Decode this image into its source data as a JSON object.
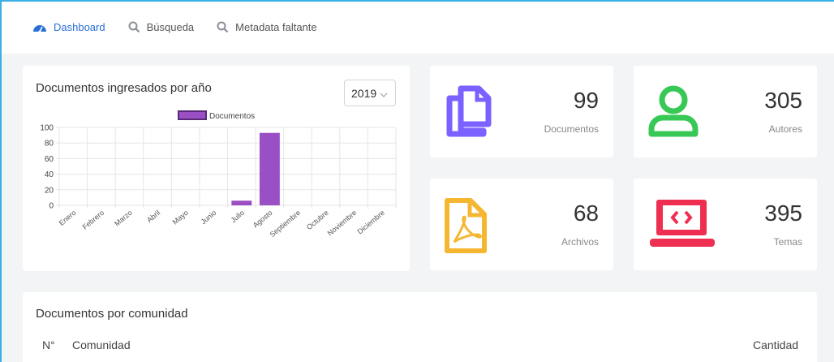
{
  "nav": {
    "dashboard": "Dashboard",
    "busqueda": "Búsqueda",
    "metadata": "Metadata faltante"
  },
  "chart_card": {
    "title": "Documentos ingresados por año",
    "year": "2019"
  },
  "chart_data": {
    "type": "bar",
    "categories": [
      "Enero",
      "Febrero",
      "Marzo",
      "Abril",
      "Mayo",
      "Junio",
      "Julio",
      "Agosto",
      "Septiembre",
      "Octubre",
      "Noviembre",
      "Diciembre"
    ],
    "series": [
      {
        "name": "Documentos",
        "values": [
          0,
          0,
          0,
          0,
          0,
          0,
          6,
          93,
          0,
          0,
          0,
          0
        ],
        "color": "#9b4fc4"
      }
    ],
    "yticks": [
      0,
      20,
      40,
      60,
      80,
      100
    ],
    "ylim": [
      0,
      100
    ],
    "legend": "top-center",
    "grid": true
  },
  "stats": [
    {
      "value": "99",
      "label": "Documentos",
      "icon": "copy-icon",
      "color": "#7b61ff"
    },
    {
      "value": "305",
      "label": "Autores",
      "icon": "user-icon",
      "color": "#37c855"
    },
    {
      "value": "68",
      "label": "Archivos",
      "icon": "pdf-file-icon",
      "color": "#f5b731"
    },
    {
      "value": "395",
      "label": "Temas",
      "icon": "laptop-code-icon",
      "color": "#ef2f52"
    }
  ],
  "table": {
    "title": "Documentos por comunidad",
    "col_num": "N°",
    "col_comunidad": "Comunidad",
    "col_cantidad": "Cantidad"
  }
}
